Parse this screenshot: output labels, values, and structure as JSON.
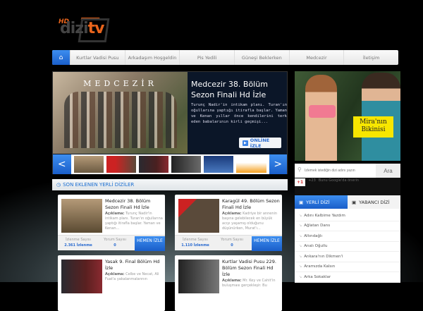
{
  "logo": {
    "hd": "HD",
    "dizi": "dizi",
    "tv": "tv"
  },
  "nav": {
    "items": [
      "Kurtlar Vadisi Pusu",
      "Arkadaşım Hoşgeldin",
      "Pis Yedili",
      "Güneşi Beklerken",
      "Medcezir",
      "İletişim"
    ]
  },
  "slider": {
    "image_title": "MEDCEZİR",
    "title": "Medcezir 38. Bölüm Sezon Finali Hd İzle",
    "description": "Turunç Nadir'in intikam planı. Turan'ın oğullarına yaptığı itirafla başlar. Yaman ve Kenan yıllar önce kendilerini terk eden babalarının kirli geçmişi...",
    "watch_label": "ONLİNE İZLE",
    "prev": "<",
    "next": ">"
  },
  "section": {
    "title": "SON EKLENEN YERLİ DİZİLER"
  },
  "cards": [
    {
      "title": "Medcezir 38. Bölüm Sezon Finali Hd İzle",
      "desc_label": "Açıklama:",
      "desc": "Turunç Nadir'in intikam planı. Turan'ın oğullarına yaptığı itirafla başlar. Yaman ve Kenan...",
      "views_label": "İzlenme Sayısı",
      "views": "2.361 İzlenme",
      "comments_label": "Yorum Sayısı",
      "comments": "0",
      "button": "HEMEN İZLE"
    },
    {
      "title": "Karagül 49. Bölüm Sezon Finali Hd İzle",
      "desc_label": "Açıklama:",
      "desc": "Kadriye bir annenin başına gelebilecek en büyük acıyı yaşamış olduğunu düşünürken, Murat'ı...",
      "views_label": "İzlenme Sayısı",
      "views": "1.110 İzlenme",
      "comments_label": "Yorum Sayısı",
      "comments": "0",
      "button": "HEMEN İZLE"
    },
    {
      "title": "Yasak 9. Final Bölüm Hd İzle",
      "desc_label": "Açıklama:",
      "desc": "Celbe ve Necat, Ali Fuat'a yakalanmalarının"
    },
    {
      "title": "Kurtlar Vadisi Pusu 229. Bölüm Sezon Finali Hd İzle",
      "desc_label": "Açıklama:",
      "desc": "Mr. Key ve Cahit'in buluşması gerçekleşir. Bu"
    }
  ],
  "ad": {
    "caption": "Mira'nın Bikinisi"
  },
  "search": {
    "placeholder": "İzlemek istediğin dizi adını yazın",
    "button": "Ara"
  },
  "gplus": {
    "label": "+1",
    "count": "+23",
    "text": "Bunu Google'da önerin"
  },
  "tabs": [
    {
      "label": "YERLİ DİZİ",
      "active": true
    },
    {
      "label": "YABANCI DİZİ",
      "active": false
    }
  ],
  "series_list": [
    "Adını Kalbime Yazdım",
    "Ağlatan Dans",
    "Altındağlı",
    "Analı Oğullu",
    "Ankara'nın Dikmen'i",
    "Aramızda Kalsın",
    "Arka Sokaklar"
  ]
}
